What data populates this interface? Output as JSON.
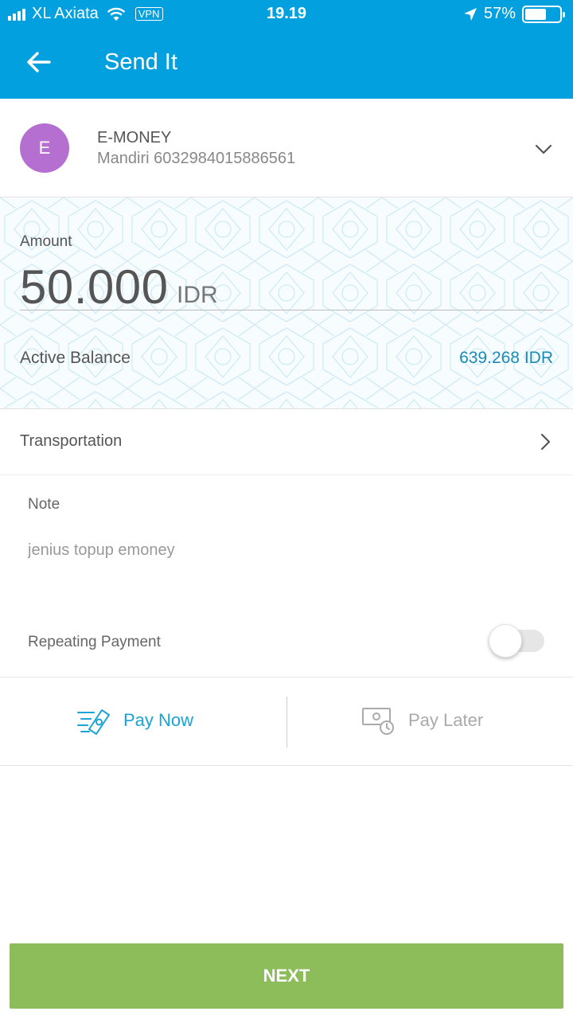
{
  "status_bar": {
    "carrier": "XL Axiata",
    "vpn_label": "VPN",
    "time": "19.19",
    "battery_percent": "57%",
    "battery_level": 0.57
  },
  "header": {
    "title": "Send It"
  },
  "account": {
    "avatar_letter": "E",
    "avatar_color": "#b46fd1",
    "name": "E-MONEY",
    "number": "Mandiri 6032984015886561"
  },
  "amount": {
    "label": "Amount",
    "value": "50.000",
    "currency": "IDR"
  },
  "balance": {
    "label": "Active Balance",
    "value": "639.268 IDR"
  },
  "category": {
    "label": "Transportation"
  },
  "note": {
    "label": "Note",
    "placeholder": "jenius topup emoney"
  },
  "repeating": {
    "label": "Repeating Payment",
    "enabled": false
  },
  "pay_options": {
    "pay_now_label": "Pay Now",
    "pay_later_label": "Pay Later",
    "selected": "Pay Now"
  },
  "next_button": {
    "label": "NEXT"
  },
  "colors": {
    "primary": "#02a0de",
    "accent_text": "#1a8bb8",
    "next_button": "#8cbd5a"
  }
}
